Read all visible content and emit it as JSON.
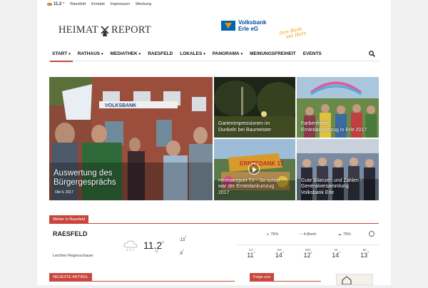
{
  "topbar": {
    "temperature": "11.2",
    "unit": "°",
    "city": "Raesfeld",
    "links": [
      "Kontakt",
      "Impressum",
      "Werbung"
    ]
  },
  "logo": {
    "left": "HEIMAT",
    "right": "REPORT"
  },
  "sponsor": {
    "name_line1": "Volksbank",
    "name_line2": "Erle eG",
    "slogan_line1": "Ihre Bank",
    "slogan_line2": "mit Herz"
  },
  "nav": {
    "items": [
      {
        "label": "START",
        "dropdown": true,
        "active": true
      },
      {
        "label": "RATHAUS",
        "dropdown": true
      },
      {
        "label": "MEDIATHEK",
        "dropdown": true
      },
      {
        "label": "RAESFELD",
        "dropdown": false
      },
      {
        "label": "LOKALES",
        "dropdown": true
      },
      {
        "label": "PANORAMA",
        "dropdown": true
      },
      {
        "label": "MEINUNGSFREIHEIT",
        "dropdown": false
      },
      {
        "label": "EVENTS",
        "dropdown": false
      }
    ],
    "chevron": "⌄"
  },
  "featured": {
    "main": {
      "title_line1": "Auswertung des",
      "title_line2": "Bürgergesprächs",
      "date": "Okt 4, 2017"
    },
    "tiles": [
      {
        "line1": "Gartenimpressionen im",
        "line2": "Dunkeln bei Baumeister",
        "line3": ""
      },
      {
        "line1": "Farbenfroher",
        "line2": "Erntedankumzug in Erle 2017",
        "line3": ""
      },
      {
        "line1": "Heimatreport TV - So schön",
        "line2": "war der Erntedankumzug",
        "line3": "2017"
      },
      {
        "line1": "Gute Bilanzen und Zahlen -",
        "line2": "Generalversammlung",
        "line3": "Volksbank Erle"
      }
    ],
    "banner_text": "ERNTEDANK 17",
    "sign_text": "VOLKSBANK"
  },
  "weather": {
    "label": "Wetter in Raesfeld",
    "city": "RAESFELD",
    "condition": "Leichter Regenschauer",
    "current": "11.2",
    "degree": "°",
    "unit": "C",
    "high": "13",
    "low": "9",
    "humidity": "76%",
    "wind": "4.6kmh",
    "clouds": "75%",
    "forecast": [
      {
        "day": "SA",
        "temp": "11"
      },
      {
        "day": "SO",
        "temp": "14"
      },
      {
        "day": "MO",
        "temp": "12"
      },
      {
        "day": "DI",
        "temp": "14"
      },
      {
        "day": "MI",
        "temp": "13"
      }
    ]
  },
  "sections": {
    "latest": "NEUESTE ARTIKEL",
    "follow": "Folge uns"
  },
  "colors": {
    "accent": "#c9463d",
    "bank_blue": "#0066b3",
    "bank_orange": "#f39200"
  }
}
